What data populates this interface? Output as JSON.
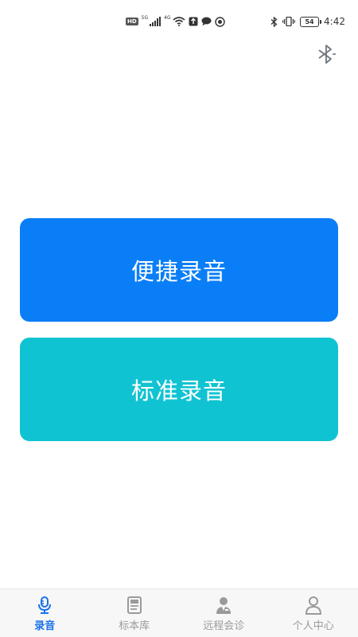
{
  "status_bar": {
    "hd_badge": "HD",
    "signal_tag_1": "5G",
    "signal_tag_2": "4G",
    "battery_level": "54",
    "time": "4:42"
  },
  "main": {
    "quick_record_label": "便捷录音",
    "standard_record_label": "标准录音"
  },
  "bottom_nav": {
    "items": [
      {
        "label": "录音",
        "icon": "microphone-icon",
        "active": true
      },
      {
        "label": "标本库",
        "icon": "document-icon",
        "active": false
      },
      {
        "label": "远程会诊",
        "icon": "doctor-icon",
        "active": false
      },
      {
        "label": "个人中心",
        "icon": "user-icon",
        "active": false
      }
    ]
  },
  "colors": {
    "quick_record_bg": "#0a7ef7",
    "standard_record_bg": "#10c3d2",
    "nav_active": "#1a73e8",
    "nav_inactive": "#9a9a9a"
  }
}
